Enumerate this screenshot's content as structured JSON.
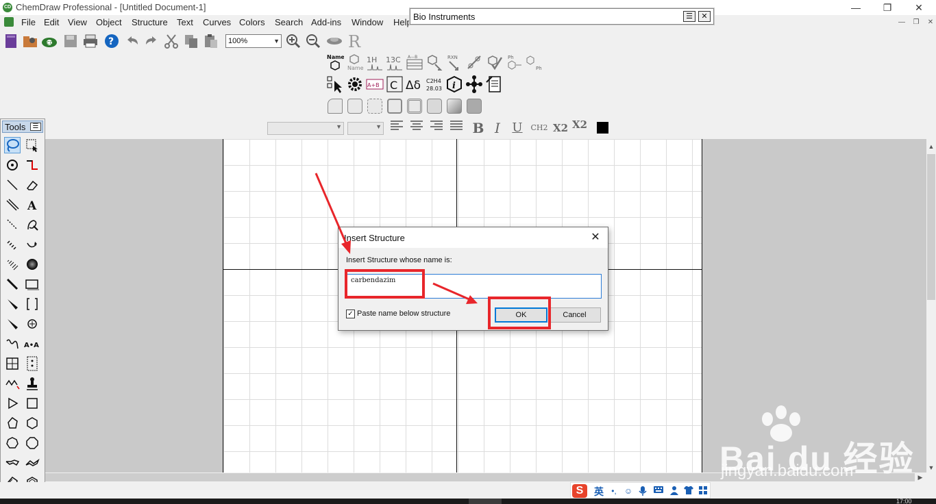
{
  "app": {
    "title": "ChemDraw Professional - [Untitled Document-1]",
    "icon": "chemdraw-icon"
  },
  "menu": [
    "File",
    "Edit",
    "View",
    "Object",
    "Structure",
    "Text",
    "Curves",
    "Colors",
    "Search",
    "Add-ins",
    "Window",
    "Help"
  ],
  "bio_instruments": {
    "title": "Bio Instruments"
  },
  "toolbar": {
    "zoom": "100%"
  },
  "chem_toolbar": {
    "name_label": "Name",
    "name_label2": "Name",
    "h1": "1H",
    "c13": "13C",
    "rxn": "RXN",
    "ph": "Ph",
    "c_label": "C",
    "delta": "Δδ",
    "formula": "C2H4",
    "mass": "28.03",
    "ab": "A+B"
  },
  "format_toolbar": {
    "bold": "B",
    "italic": "I",
    "underline": "U",
    "ch2": "CH2",
    "subscript": "X2",
    "superscript": "X2"
  },
  "tools_panel": {
    "title": "Tools",
    "text_tool": "A",
    "map_tool": "A•A"
  },
  "dialog": {
    "title": "Insert Structure",
    "prompt": "Insert Structure whose name is:",
    "input_value": "carbendazim",
    "checkbox_label": "Paste name below structure",
    "checkbox_checked": true,
    "ok": "OK",
    "cancel": "Cancel"
  },
  "ime": {
    "logo": "S",
    "lang": "英",
    "punct": "•,"
  },
  "watermark": {
    "brand": "Bai du 经验",
    "url": "jingyan.baidu.com"
  },
  "clock": "17:00",
  "colors": {
    "highlight": "#e8262b",
    "accent": "#0078d7",
    "canvas": "#ffffff",
    "workspace": "#c9c9c9"
  }
}
